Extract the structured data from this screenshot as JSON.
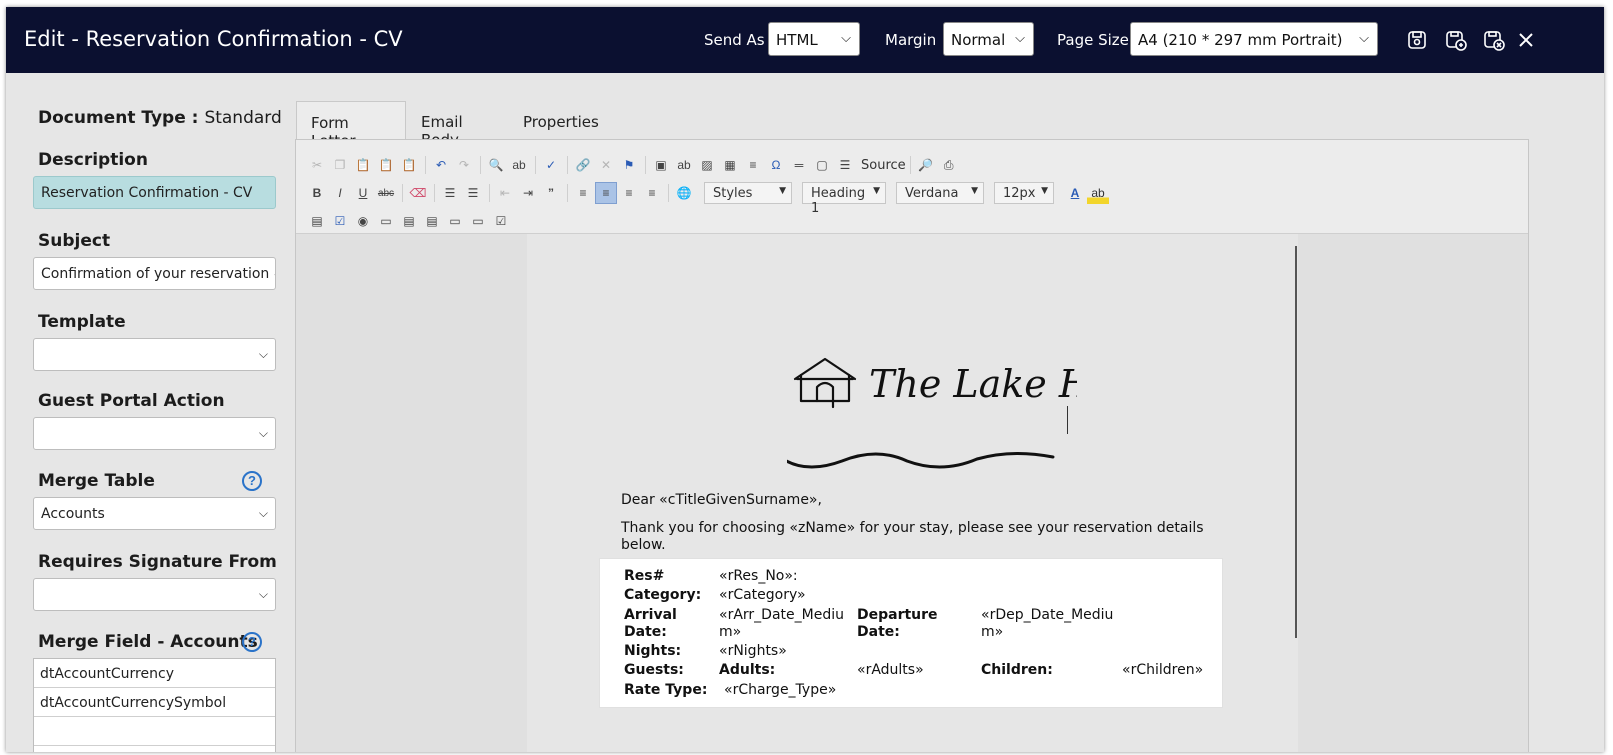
{
  "header": {
    "title": "Edit - Reservation Confirmation - CV",
    "send_as_label": "Send As",
    "send_as_value": "HTML",
    "margin_label": "Margin",
    "margin_value": "Normal",
    "page_size_label": "Page Size",
    "page_size_value": "A4 (210 * 297 mm Portrait)",
    "icons": [
      "save-icon",
      "save-copy-icon",
      "save-close-icon",
      "close-icon"
    ]
  },
  "left": {
    "doc_type_label": "Document Type :",
    "doc_type_value": "Standard",
    "description_label": "Description",
    "description_value": "Reservation Confirmation - CV",
    "subject_label": "Subject",
    "subject_value": "Confirmation of your reservation #«r",
    "template_label": "Template",
    "template_value": "",
    "guest_portal_label": "Guest Portal Action",
    "guest_portal_value": "",
    "merge_table_label": "Merge Table",
    "merge_table_value": "Accounts",
    "requires_sig_label": "Requires Signature From",
    "requires_sig_value": "",
    "merge_field_label": "Merge Field - Accounts",
    "merge_fields": [
      "dtAccountCurrency",
      "dtAccountCurrencySymbol",
      ""
    ],
    "help_glyph": "?"
  },
  "tabs": [
    "Form Letter",
    "Email Body",
    "Properties"
  ],
  "toolbar": {
    "source_label": "Source",
    "styles": "Styles",
    "heading": "Heading 1",
    "font": "Verdana",
    "size": "12px"
  },
  "letter": {
    "greeting": "Dear «cTitleGivenSurname»,",
    "intro_line1": "Thank you for choosing «zName» for your stay, please see your reservation details",
    "intro_line2": "below.",
    "res_label": "Res#",
    "res_value": "«rRes_No»:",
    "category_label": "Category:",
    "category_value": "«rCategory»",
    "arrival_label_1": "Arrival",
    "arrival_label_2": "Date:",
    "arrival_value_1": "«rArr_Date_Mediu",
    "arrival_value_2": "m»",
    "departure_label_1": "Departure",
    "departure_label_2": "Date:",
    "departure_value_1": "«rDep_Date_Mediu",
    "departure_value_2": "m»",
    "nights_label": "Nights:",
    "nights_value": "«rNights»",
    "guests_label": "Guests:",
    "adults_label": "Adults:",
    "adults_value": "«rAdults»",
    "children_label": "Children:",
    "children_value": "«rChildren»",
    "rate_label": "Rate Type:",
    "rate_value": "«rCharge_Type»"
  },
  "colors": {
    "header_bg": "#0b1030",
    "description_highlight": "#b8dde0",
    "help_blue": "#2a73c9"
  }
}
